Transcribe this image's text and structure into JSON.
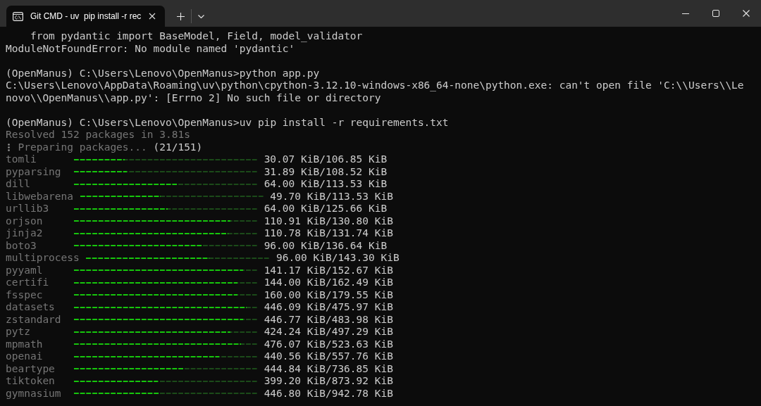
{
  "window": {
    "tabs": [
      {
        "title": "Git CMD - uv  pip install -r rec",
        "selected": true
      }
    ]
  },
  "terminal": {
    "lines": [
      {
        "kind": "output",
        "text": "    from pydantic import BaseModel, Field, model_validator"
      },
      {
        "kind": "output",
        "text": "ModuleNotFoundError: No module named 'pydantic'"
      },
      {
        "kind": "blank"
      },
      {
        "kind": "output",
        "text": "(OpenManus) C:\\Users\\Lenovo\\OpenManus>python app.py"
      },
      {
        "kind": "output",
        "text": "C:\\Users\\Lenovo\\AppData\\Roaming\\uv\\python\\cpython-3.12.10-windows-x86_64-none\\python.exe: can't open file 'C:\\\\Users\\\\Le"
      },
      {
        "kind": "output",
        "text": "novo\\\\OpenManus\\\\app.py': [Errno 2] No such file or directory"
      },
      {
        "kind": "blank"
      },
      {
        "kind": "output",
        "text": "(OpenManus) C:\\Users\\Lenovo\\OpenManus>uv pip install -r requirements.txt"
      },
      {
        "kind": "dim",
        "text": "Resolved 152 packages in 3.81s"
      },
      {
        "kind": "status",
        "message": "Preparing packages...",
        "count": "(21/151)"
      }
    ],
    "downloads": [
      {
        "name": "tomli",
        "level": 0.28,
        "reading": "30.07 KiB/106.85 KiB"
      },
      {
        "name": "pyparsing",
        "level": 0.29,
        "reading": "31.89 KiB/108.52 KiB"
      },
      {
        "name": "dill",
        "level": 0.56,
        "reading": "64.00 KiB/113.53 KiB"
      },
      {
        "name": "libwebarena",
        "level": 0.44,
        "reading": "49.70 KiB/113.53 KiB"
      },
      {
        "name": "urllib3",
        "level": 0.51,
        "reading": "64.00 KiB/125.66 KiB"
      },
      {
        "name": "orjson",
        "level": 0.85,
        "reading": "110.91 KiB/130.80 KiB"
      },
      {
        "name": "jinja2",
        "level": 0.84,
        "reading": "110.78 KiB/131.74 KiB"
      },
      {
        "name": "boto3",
        "level": 0.7,
        "reading": "96.00 KiB/136.64 KiB"
      },
      {
        "name": "multiprocess",
        "level": 0.67,
        "reading": "96.00 KiB/143.30 KiB"
      },
      {
        "name": "pyyaml",
        "level": 0.92,
        "reading": "141.17 KiB/152.67 KiB"
      },
      {
        "name": "certifi",
        "level": 0.89,
        "reading": "144.00 KiB/162.49 KiB"
      },
      {
        "name": "fsspec",
        "level": 0.89,
        "reading": "160.00 KiB/179.55 KiB"
      },
      {
        "name": "datasets",
        "level": 0.94,
        "reading": "446.09 KiB/475.97 KiB"
      },
      {
        "name": "zstandard",
        "level": 0.92,
        "reading": "446.77 KiB/483.98 KiB"
      },
      {
        "name": "pytz",
        "level": 0.85,
        "reading": "424.24 KiB/497.29 KiB"
      },
      {
        "name": "mpmath",
        "level": 0.91,
        "reading": "476.07 KiB/523.63 KiB"
      },
      {
        "name": "openai",
        "level": 0.79,
        "reading": "440.56 KiB/557.76 KiB"
      },
      {
        "name": "beartype",
        "level": 0.6,
        "reading": "444.84 KiB/736.85 KiB"
      },
      {
        "name": "tiktoken",
        "level": 0.46,
        "reading": "399.20 KiB/873.92 KiB"
      },
      {
        "name": "gymnasium",
        "level": 0.47,
        "reading": "446.80 KiB/942.78 KiB"
      }
    ]
  }
}
